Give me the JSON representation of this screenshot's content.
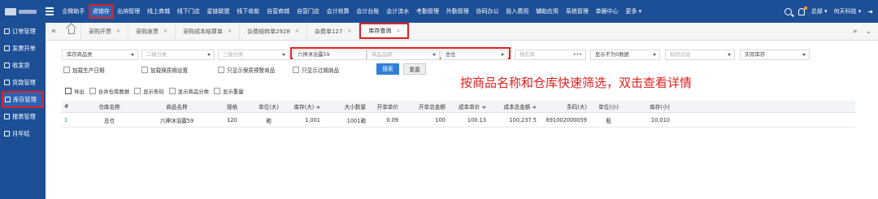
{
  "top_menu": [
    "企微助手",
    "进销存",
    "出纳管理",
    "线上商城",
    "线下门店",
    "星链联盟",
    "线下收款",
    "自营商城",
    "自营门店",
    "会计核算",
    "会计台账",
    "会计流水",
    "考勤管理",
    "外勤管理",
    "协同办公",
    "投入费用",
    "辅助应用",
    "系统管理",
    "单据中心",
    "更多 ▾"
  ],
  "top_menu_active_index": 1,
  "top_right": {
    "user": "总部 ▾",
    "company": "何天科技 ▾"
  },
  "sidebar": [
    {
      "label": "订单管理",
      "active": false
    },
    {
      "label": "发票开单",
      "active": false
    },
    {
      "label": "收发货",
      "active": false
    },
    {
      "label": "货款管理",
      "active": false
    },
    {
      "label": "库存管理",
      "active": true
    },
    {
      "label": "报表管理",
      "active": false
    },
    {
      "label": "月年结",
      "active": false
    }
  ],
  "tabs": [
    {
      "label": "采购开票",
      "active": false
    },
    {
      "label": "采购发票",
      "active": false
    },
    {
      "label": "采购成本结算单",
      "active": false
    },
    {
      "label": "杂费结转单2928",
      "active": false
    },
    {
      "label": "杂费单127",
      "active": false
    },
    {
      "label": "库存查询",
      "active": true
    }
  ],
  "filters": {
    "category": "库存商品类",
    "level2": "二级分类",
    "level3": "三级分类",
    "product_name": "六神沐浴露59",
    "brand": "商品品牌",
    "warehouse": "总仓",
    "supplier": "供应商",
    "display_mode": "显示不为0数据",
    "tag_filter": "标识过滤",
    "stock_type": "实际库存",
    "checkboxes": [
      "加载生产日期",
      "加载保质期设置",
      "只显示保质预警商品",
      "只显示过期商品"
    ],
    "search_label": "搜索",
    "reset_label": "重置"
  },
  "annotation": "按商品名称和仓库快速筛选，双击查看详情",
  "toolbar": {
    "export": "导出",
    "options": [
      "合并仓库数据",
      "显示条码",
      "显示商品分类",
      "显示重量"
    ]
  },
  "table": {
    "columns": [
      "#",
      "仓库名称",
      "商品名称",
      "规格",
      "单位(大)",
      "库存(大) ≑",
      "大小数量",
      "开单单价",
      "开单总金额",
      "成本单价 ≑",
      "成本总金额 ≑",
      "条码(大)",
      "单位(小)",
      "库存(小)"
    ],
    "rows": [
      [
        "1",
        "总仓",
        "六神沐浴露59",
        "120",
        "箱",
        "1,001",
        "1001箱",
        "0.09",
        "100",
        "100.13",
        "100,237.5",
        "691002000059",
        "瓶",
        "10,010"
      ]
    ]
  },
  "colors": {
    "nav_bg": "#1d4f96",
    "highlight": "#e02020",
    "primary_button": "#2f7fd8"
  }
}
